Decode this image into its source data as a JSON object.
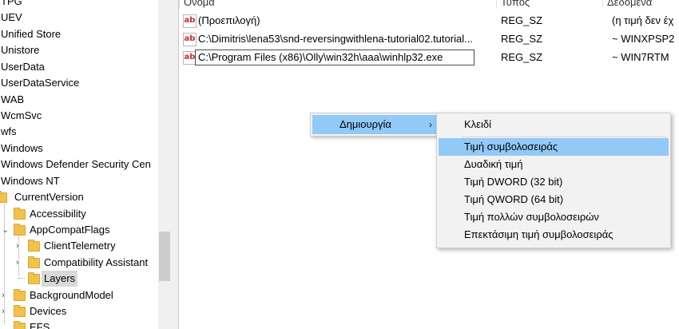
{
  "tree": {
    "items": [
      {
        "label": "TPG",
        "expander": ""
      },
      {
        "label": "UEV",
        "expander": ""
      },
      {
        "label": "Unified Store",
        "expander": ""
      },
      {
        "label": "Unistore",
        "expander": ""
      },
      {
        "label": "UserData",
        "expander": ""
      },
      {
        "label": "UserDataService",
        "expander": ""
      },
      {
        "label": "WAB",
        "expander": ""
      },
      {
        "label": "WcmSvc",
        "expander": ""
      },
      {
        "label": "wfs",
        "expander": ""
      },
      {
        "label": "Windows",
        "expander": ""
      },
      {
        "label": "Windows Defender Security Cen",
        "expander": ""
      },
      {
        "label": "Windows NT",
        "expander": ""
      },
      {
        "label": "CurrentVersion",
        "expander": ""
      },
      {
        "label": "Accessibility",
        "expander": ""
      },
      {
        "label": "AppCompatFlags",
        "expander": "⌄"
      },
      {
        "label": "ClientTelemetry",
        "expander": "›"
      },
      {
        "label": "Compatibility Assistant",
        "expander": "›"
      },
      {
        "label": "Layers",
        "expander": ""
      },
      {
        "label": "BackgroundModel",
        "expander": "›"
      },
      {
        "label": "Devices",
        "expander": "›"
      },
      {
        "label": "EFS",
        "expander": ""
      }
    ]
  },
  "values_pane": {
    "columns": {
      "name": "Όνομα",
      "type": "Τύπος",
      "data": "Δεδομένα"
    },
    "rows": [
      {
        "icon": "ab",
        "name": "(Προεπιλογή)",
        "type": "REG_SZ",
        "data": "(η τιμή δεν έχ"
      },
      {
        "icon": "ab",
        "name": "C:\\Dimitris\\lena53\\snd-reversingwithlena-tutorial02.tutorial...",
        "type": "REG_SZ",
        "data": "~ WINXPSP2"
      },
      {
        "icon": "ab",
        "name": "C:\\Program Files (x86)\\Olly\\win32h\\aaa\\winhlp32.exe",
        "type": "REG_SZ",
        "data": "~ WIN7RTM"
      }
    ]
  },
  "context_menu": {
    "new_label": "Δημιουργία",
    "submenu_arrow": "›",
    "submenu": [
      "Κλειδί",
      "Τιμή συμβολοσειράς",
      "Δυαδική τιμή",
      "Τιμή DWORD (32 bit)",
      "Τιμή QWORD (64 bit)",
      "Τιμή πολλών συμβολοσειρών",
      "Επεκτάσιμη τιμή συμβολοσειράς"
    ]
  },
  "colors": {
    "menu_highlight": "#91c9f7",
    "folder": "#f0c24d",
    "string_icon": "#c4302b"
  },
  "icons": {
    "folder": "folder-icon",
    "string_value": "reg-string-icon",
    "chevron": "chevron-icon"
  }
}
